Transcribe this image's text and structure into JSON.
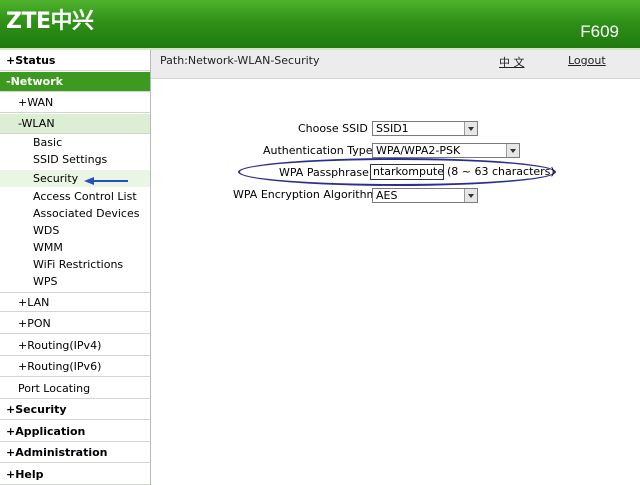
{
  "header": {
    "logo": "ZTE中兴",
    "model": "F609"
  },
  "path": {
    "text": "Path:Network-WLAN-Security",
    "language": "中 文",
    "logout": "Logout"
  },
  "sidebar": {
    "status": "Status",
    "network": "Network",
    "wan": "WAN",
    "wlan": "WLAN",
    "wlan_items": [
      "Basic",
      "SSID Settings",
      "Security",
      "Access Control List",
      "Associated Devices",
      "WDS",
      "WMM",
      "WiFi Restrictions",
      "WPS"
    ],
    "lan": "LAN",
    "pon": "PON",
    "routing4": "Routing(IPv4)",
    "routing6": "Routing(IPv6)",
    "port": "Port Locating",
    "security": "Security",
    "application": "Application",
    "administration": "Administration",
    "help": "Help"
  },
  "form": {
    "ssid_label": "Choose SSID",
    "ssid_value": "SSID1",
    "auth_label": "Authentication Type",
    "auth_value": "WPA/WPA2-PSK",
    "pass_label": "WPA Passphrase",
    "pass_value": "ntarkomputer",
    "pass_hint": "(8 ~ 63 characters)",
    "enc_label": "WPA Encryption Algorithm",
    "enc_value": "AES"
  },
  "colors": {
    "header_green": "#2f9118",
    "active_green": "#3c9a20",
    "highlight_ellipse": "#2a2f8f",
    "arrow": "#2a4fbf"
  }
}
